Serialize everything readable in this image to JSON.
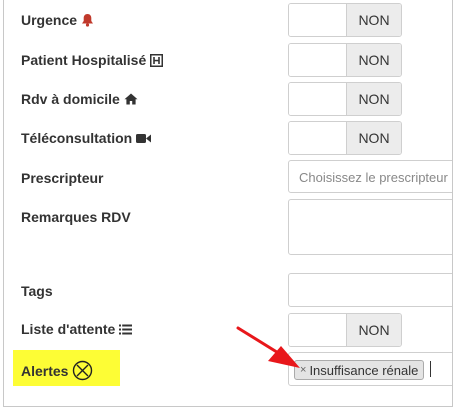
{
  "fields": {
    "urgence": {
      "label": "Urgence",
      "value": "NON",
      "icon": "bell-icon"
    },
    "hospitalise": {
      "label": "Patient Hospitalisé",
      "value": "NON",
      "icon": "hospital-icon"
    },
    "domicile": {
      "label": "Rdv à domicile",
      "value": "NON",
      "icon": "home-icon"
    },
    "teleconsultation": {
      "label": "Téléconsultation",
      "value": "NON",
      "icon": "video-camera-icon"
    },
    "prescripteur": {
      "label": "Prescripteur",
      "placeholder": "Choisissez le prescripteur"
    },
    "remarques": {
      "label": "Remarques RDV",
      "value": ""
    },
    "tags": {
      "label": "Tags",
      "value": ""
    },
    "liste_attente": {
      "label": "Liste d'attente",
      "value": "NON",
      "icon": "list-icon"
    },
    "alertes": {
      "label": "Alertes",
      "icon": "circled-x-icon",
      "chips": [
        {
          "label": "Insuffisance rénale",
          "remove": "×"
        }
      ]
    }
  },
  "colors": {
    "bell": "#c0392b",
    "highlight": "#fdfd35",
    "arrow": "#e8171b"
  }
}
